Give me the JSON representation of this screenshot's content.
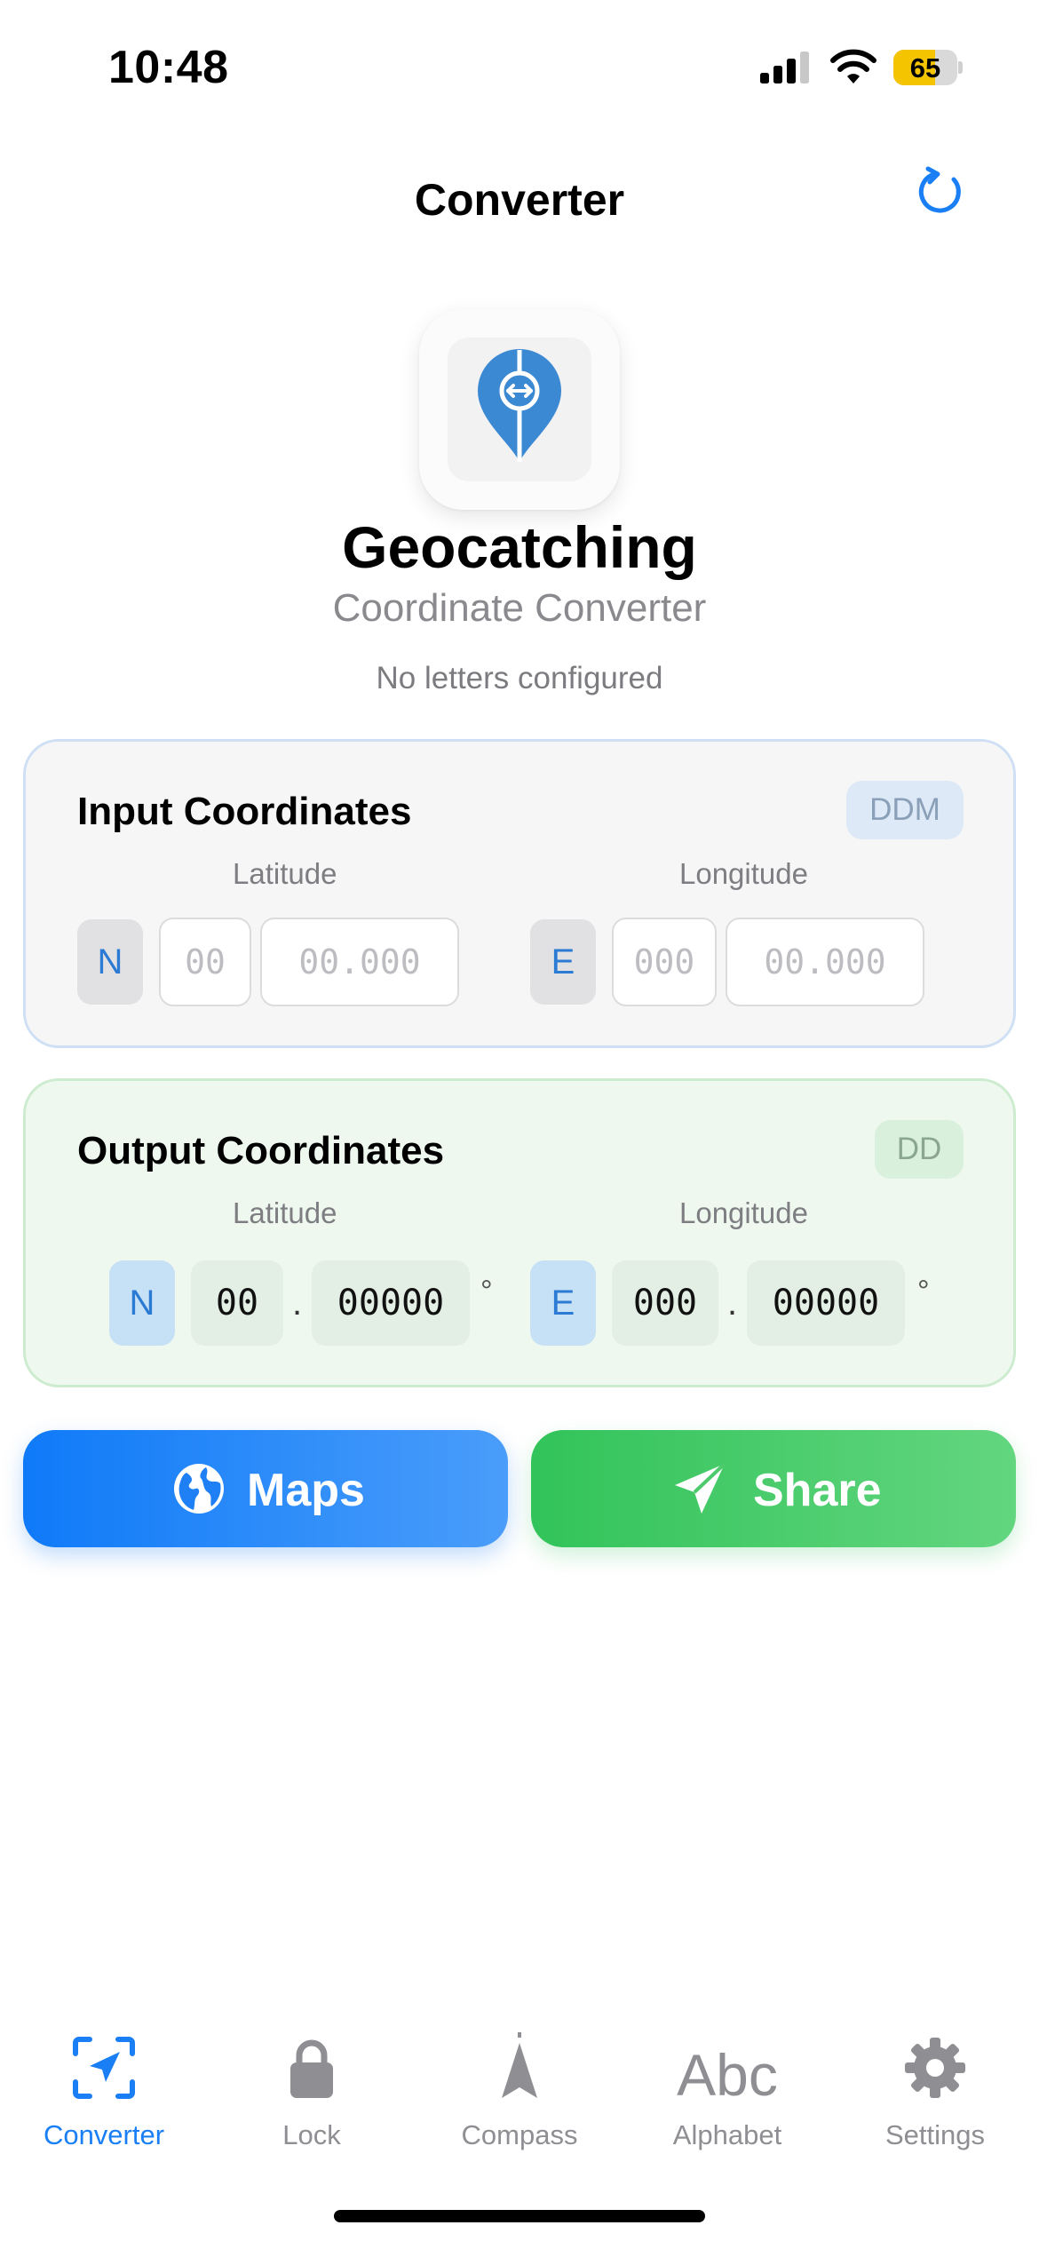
{
  "status_bar": {
    "time": "10:48",
    "battery": "65",
    "battery_level": 0.65
  },
  "header": {
    "title": "Converter"
  },
  "hero": {
    "app_name": "Geocatching",
    "subtitle": "Coordinate Converter",
    "letters_status": "No letters configured"
  },
  "input_card": {
    "title": "Input Coordinates",
    "format": "DDM",
    "latitude_label": "Latitude",
    "longitude_label": "Longitude",
    "lat_hemisphere": "N",
    "lat_degrees_placeholder": "00",
    "lat_minutes_placeholder": "00.000",
    "lon_hemisphere": "E",
    "lon_degrees_placeholder": "000",
    "lon_minutes_placeholder": "00.000"
  },
  "output_card": {
    "title": "Output Coordinates",
    "format": "DD",
    "latitude_label": "Latitude",
    "longitude_label": "Longitude",
    "lat_hemisphere": "N",
    "lat_int": "00",
    "lat_frac": "00000",
    "lon_hemisphere": "E",
    "lon_int": "000",
    "lon_frac": "00000",
    "decimal_sep": ".",
    "degree_symbol": "°"
  },
  "actions": {
    "maps_label": "Maps",
    "share_label": "Share"
  },
  "tabs": [
    {
      "label": "Converter",
      "icon": "location-arrow-viewfinder-icon",
      "active": true
    },
    {
      "label": "Lock",
      "icon": "lock-icon",
      "active": false
    },
    {
      "label": "Compass",
      "icon": "compass-needle-icon",
      "active": false
    },
    {
      "label": "Alphabet",
      "icon": "abc-text-icon",
      "glyph": "Abc",
      "active": false
    },
    {
      "label": "Settings",
      "icon": "gear-icon",
      "active": false
    }
  ],
  "colors": {
    "accent": "#1a7ff5",
    "maps_button": "#0f7af8",
    "share_button": "#32c35a",
    "input_card_border": "#cfe0f5",
    "output_card_background": "#eef8ef"
  }
}
